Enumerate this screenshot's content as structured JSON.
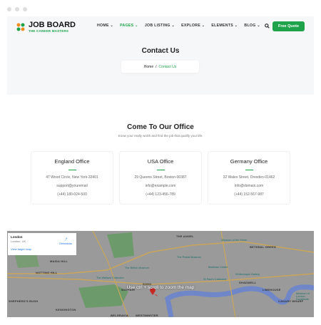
{
  "header": {
    "logo_title": "JOB BOARD",
    "logo_tagline": "THE CAREER MASTERS",
    "nav": [
      {
        "label": "HOME"
      },
      {
        "label": "PAGES",
        "active": true
      },
      {
        "label": "JOB LISTING"
      },
      {
        "label": "EXPLORE"
      },
      {
        "label": "ELEMENTS"
      },
      {
        "label": "BLOG"
      }
    ],
    "search_icon": "search-icon",
    "cta": "Free Quote",
    "accent": "#1ea34a"
  },
  "hero": {
    "title": "Contact Us",
    "breadcrumb": {
      "home": "Home",
      "sep": "/",
      "current": "Contact Us"
    }
  },
  "section": {
    "title": "Come To Our Office",
    "subtitle": "Know your really worth and find the job that qualify your life."
  },
  "offices": [
    {
      "name": "England Office",
      "address": "47 Wood Circle, New York-32401",
      "email": "support@youremail",
      "phone": "(+44) 180-024-500"
    },
    {
      "name": "USA Office",
      "address": "29 Queens Street, Boston-00387",
      "email": "info@example.com",
      "phone": "(+44) 123-456-789"
    },
    {
      "name": "Germany Office",
      "address": "32 Wales Street, Dresden-01462",
      "email": "info@domain.com",
      "phone": "(+44) 152-567-987"
    }
  ],
  "map": {
    "place": "London",
    "region": "London, UK",
    "directions": "Directions",
    "larger": "View larger map",
    "overlay": "Use ctrl + scroll to zoom the map",
    "labels": [
      "THE ANGEL",
      "NOTTING HILL",
      "SHEPHERD'S BUSH",
      "KENSINGTON",
      "SOHO",
      "MAYFAIR",
      "BELGRAVIA",
      "WESTMINSTER",
      "SHADWELL",
      "LIMEHOUSE",
      "CANARY WHARF",
      "BETHNAL GREEN",
      "MAIDA HILL"
    ],
    "places": [
      "The British Museum",
      "The Postal Museum",
      "Barbican Centre",
      "The Wallace Collection",
      "St Paul's Cathedral",
      "Museum of the Home",
      "Whitechapel Gallery",
      "Museum of London Docklands"
    ]
  }
}
